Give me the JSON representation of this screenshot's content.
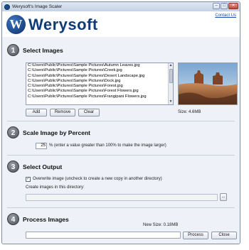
{
  "window": {
    "title": "Werysoft's Image Scaler",
    "controls": {
      "minimize": "–",
      "maximize": "□",
      "close": "✕"
    }
  },
  "header": {
    "logo_letter": "W",
    "logo_text": "Werysoft",
    "contact_link": "Contact Us"
  },
  "sections": {
    "select_images": {
      "number": "1",
      "title": "Select Images",
      "files": [
        "C:\\Users\\Public\\Pictures\\Sample Pictures\\Autumn Leaves.jpg",
        "C:\\Users\\Public\\Pictures\\Sample Pictures\\Creek.jpg",
        "C:\\Users\\Public\\Pictures\\Sample Pictures\\Desert Landscape.jpg",
        "C:\\Users\\Public\\Pictures\\Sample Pictures\\Dock.jpg",
        "C:\\Users\\Public\\Pictures\\Sample Pictures\\Forest.jpg",
        "C:\\Users\\Public\\Pictures\\Sample Pictures\\Forest Flowers.jpg",
        "C:\\Users\\Public\\Pictures\\Sample Pictures\\Frangipani Flowers.jpg"
      ],
      "buttons": {
        "add": "Add",
        "remove": "Remove",
        "clear": "Clear"
      },
      "size_label": "Size: 4.6MB"
    },
    "scale": {
      "number": "2",
      "title": "Scale Image by Percent",
      "percent_value": "25",
      "help": "% (enter a value greater than 100% to make the image larger)"
    },
    "output": {
      "number": "3",
      "title": "Select Output",
      "overwrite_checked": true,
      "overwrite_label": "Overwrite image (uncheck to create a new copy in another directory)",
      "directory_label": "Create images in this directory:",
      "directory_value": "",
      "browse_label": "..."
    },
    "process": {
      "number": "4",
      "title": "Process Images",
      "new_size_label": "New Size: 0.18MB",
      "progress": 0,
      "buttons": {
        "process": "Process",
        "close": "Close"
      }
    }
  }
}
